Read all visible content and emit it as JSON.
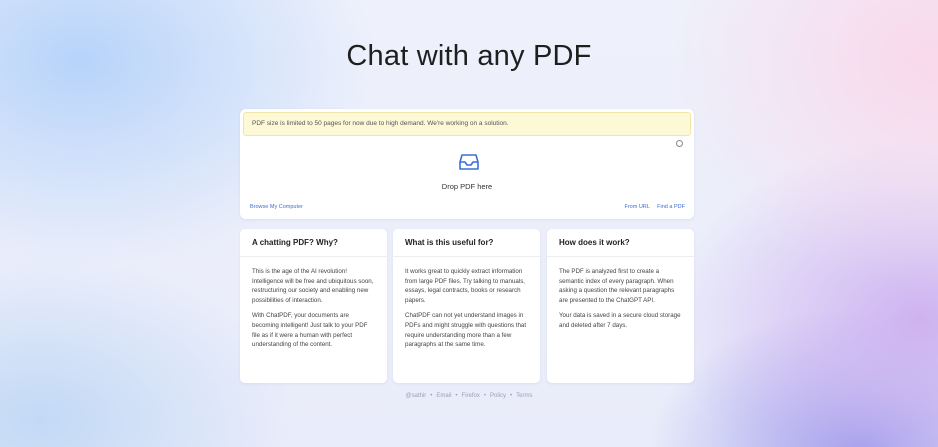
{
  "header": {
    "title": "Chat with any PDF"
  },
  "upload": {
    "notice": "PDF size is limited to 50 pages for now due to high demand. We're working on a solution.",
    "drop_label": "Drop PDF here",
    "browse_label": "Browse My Computer",
    "from_url_label": "From URL",
    "find_pdf_label": "Find a PDF"
  },
  "cards": [
    {
      "title": "A chatting PDF? Why?",
      "paragraphs": [
        "This is the age of the AI revolution! Intelligence will be free and ubiquitous soon, restructuring our society and enabling new possibilities of interaction.",
        "With ChatPDF, your documents are becoming intelligent! Just talk to your PDF file as if it were a human with perfect understanding of the content."
      ]
    },
    {
      "title": "What is this useful for?",
      "paragraphs": [
        "It works great to quickly extract information from large PDF files. Try talking to manuals, essays, legal contracts, books or research papers.",
        "ChatPDF can not yet understand images in PDFs and might struggle with questions that require understanding more than a few paragraphs at the same time."
      ]
    },
    {
      "title": "How does it work?",
      "paragraphs": [
        "The PDF is analyzed first to create a semantic index of every paragraph. When asking a question the relevant paragraphs are presented to the ChatGPT API.",
        "Your data is saved in a secure cloud storage and deleted after 7 days."
      ]
    }
  ],
  "footer": {
    "links": [
      "@sathir",
      "Email",
      "Firefox",
      "Policy",
      "Terms"
    ],
    "separator": "•"
  },
  "colors": {
    "link": "#3b6fd8",
    "notice_bg": "#fdf8d6",
    "icon": "#3b6fd8"
  }
}
